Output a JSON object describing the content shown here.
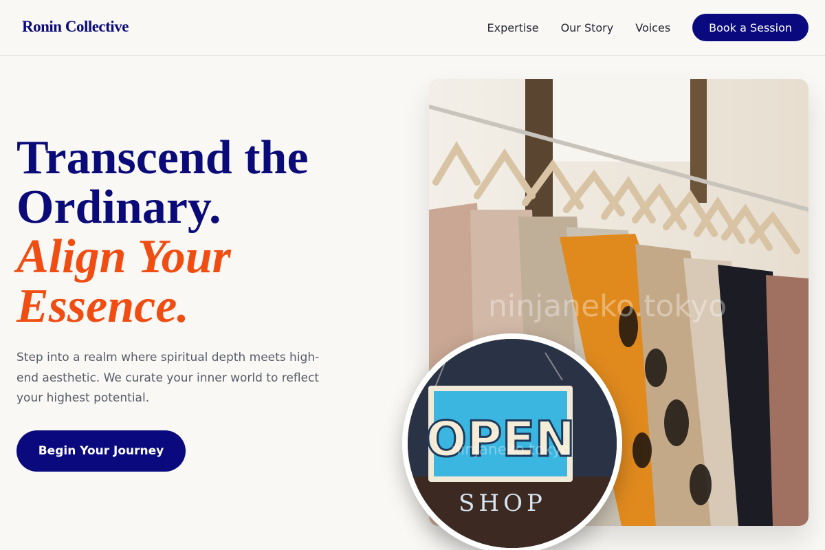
{
  "header": {
    "brand": "Ronin Collective",
    "nav": [
      {
        "label": "Expertise"
      },
      {
        "label": "Our Story"
      },
      {
        "label": "Voices"
      }
    ],
    "cta_label": "Book a Session"
  },
  "hero": {
    "title_line1": "Transcend the",
    "title_line2": "Ordinary.",
    "accent_line1": "Align Your",
    "accent_line2": "Essence.",
    "description": "Step into a realm where spiritual depth meets high-end aesthetic. We curate your inner world to reflect your highest potential.",
    "cta_label": "Begin Your Journey"
  },
  "images": {
    "main_watermark": "ninjaneko.tokyo",
    "sign_text": "OPEN",
    "shop_text": "SHOP",
    "sign_watermark": "ninjaneko.tokyo"
  },
  "colors": {
    "brand_navy": "#0a0a7e",
    "accent_orange": "#f04d12",
    "background": "#faf8f5",
    "sign_blue": "#3ab6e0"
  }
}
